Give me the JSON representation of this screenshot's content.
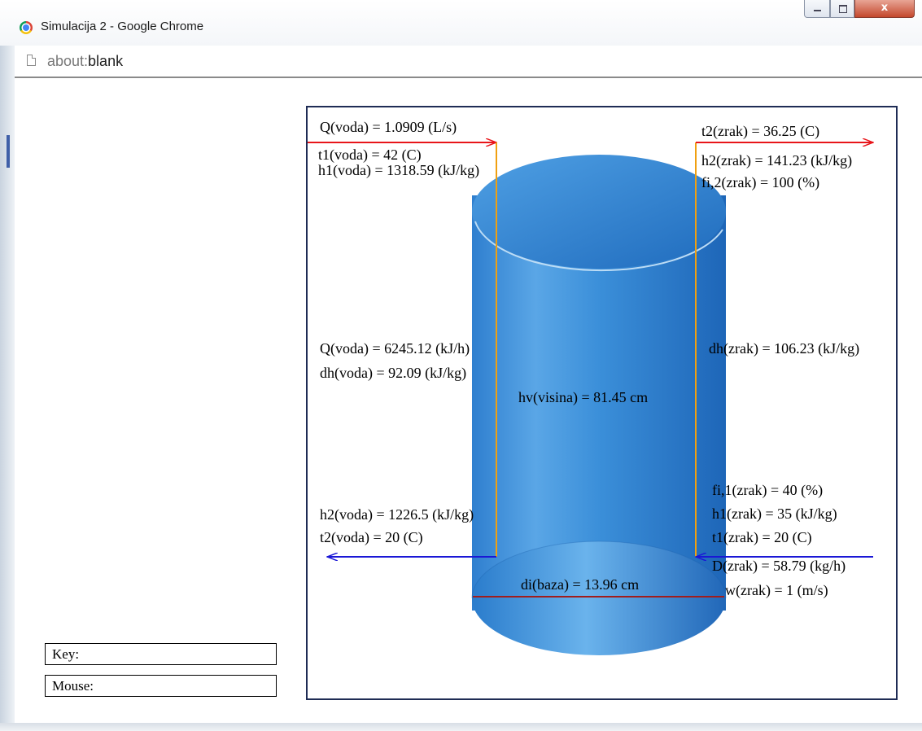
{
  "window": {
    "title": "Simulacija 2 - Google Chrome",
    "close_glyph": "x",
    "icons": [
      "chrome-logo-icon",
      "minimize-icon",
      "maximize-icon",
      "close-icon",
      "page-icon"
    ]
  },
  "address": {
    "scheme": "about:",
    "host": "blank"
  },
  "panels": {
    "key_label": "Key:",
    "mouse_label": "Mouse:"
  },
  "simulation": {
    "colors": {
      "water_in": "#e8151a",
      "water_out": "#1a17d6",
      "vertical_line": "#f0a010",
      "diameter_line": "#a01d1d",
      "frame": "#1f2c55",
      "cylinder": "#2f7fd0"
    },
    "labels": {
      "q_voda_ls": "Q(voda) = 1.0909 (L/s)",
      "t1_voda": "t1(voda) = 42 (C)",
      "h1_voda": "h1(voda) = 1318.59 (kJ/kg)",
      "q_voda_kjh": "Q(voda) = 6245.12 (kJ/h)",
      "dh_voda": "dh(voda) = 92.09 (kJ/kg)",
      "h2_voda": "h2(voda) = 1226.5 (kJ/kg)",
      "t2_voda": "t2(voda) = 20 (C)",
      "t2_zrak": "t2(zrak) = 36.25 (C)",
      "h2_zrak": "h2(zrak) = 141.23 (kJ/kg)",
      "fi2_zrak": "fi,2(zrak) = 100 (%)",
      "dh_zrak": "dh(zrak) = 106.23 (kJ/kg)",
      "hv_visina": "hv(visina) = 81.45 cm",
      "fi1_zrak": "fi,1(zrak) = 40 (%)",
      "h1_zrak": "h1(zrak) = 35 (kJ/kg)",
      "t1_zrak": "t1(zrak) = 20 (C)",
      "d_zrak": "D(zrak) = 58.79 (kg/h)",
      "w_zrak": "w(zrak) = 1 (m/s)",
      "di_baza": "di(baza) = 13.96 cm"
    }
  }
}
